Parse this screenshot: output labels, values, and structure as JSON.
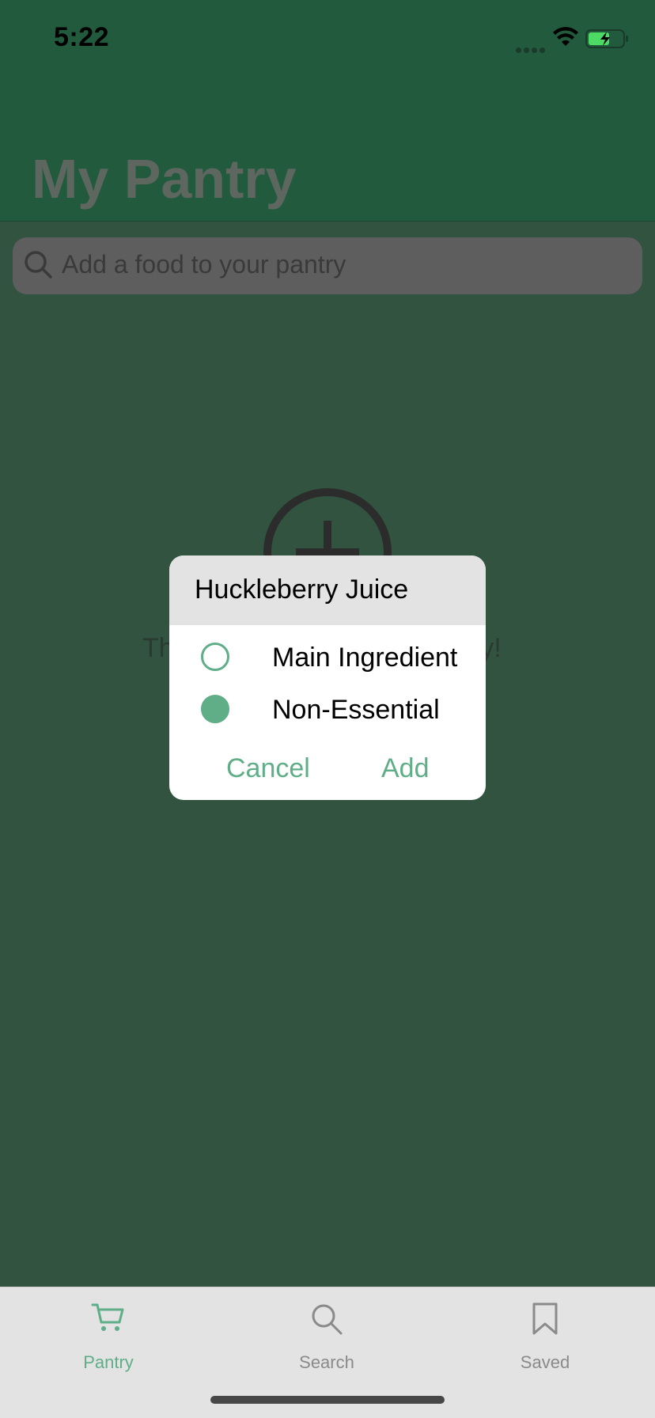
{
  "status_bar": {
    "time": "5:22",
    "icons": [
      "signal-icon",
      "wifi-icon",
      "battery-charging-icon"
    ]
  },
  "header": {
    "title": "My Pantry"
  },
  "search": {
    "placeholder": "Add a food to your pantry",
    "icon": "search-icon"
  },
  "empty_state": {
    "icon": "plus-circle-icon",
    "text_left": "Th",
    "text_right": "ry!"
  },
  "dialog": {
    "title": "Huckleberry Juice",
    "options": [
      {
        "label": "Main Ingredient",
        "selected": false
      },
      {
        "label": "Non-Essential",
        "selected": true
      }
    ],
    "cancel_label": "Cancel",
    "add_label": "Add"
  },
  "tab_bar": {
    "tabs": [
      {
        "label": "Pantry",
        "icon": "cart-icon",
        "active": true
      },
      {
        "label": "Search",
        "icon": "search-icon",
        "active": false
      },
      {
        "label": "Saved",
        "icon": "bookmark-icon",
        "active": false
      }
    ]
  },
  "colors": {
    "accent": "#5FAE88",
    "header_bg": "#225A3E",
    "body_bg": "#31533F",
    "tab_bar_bg": "#E3E3E3"
  }
}
